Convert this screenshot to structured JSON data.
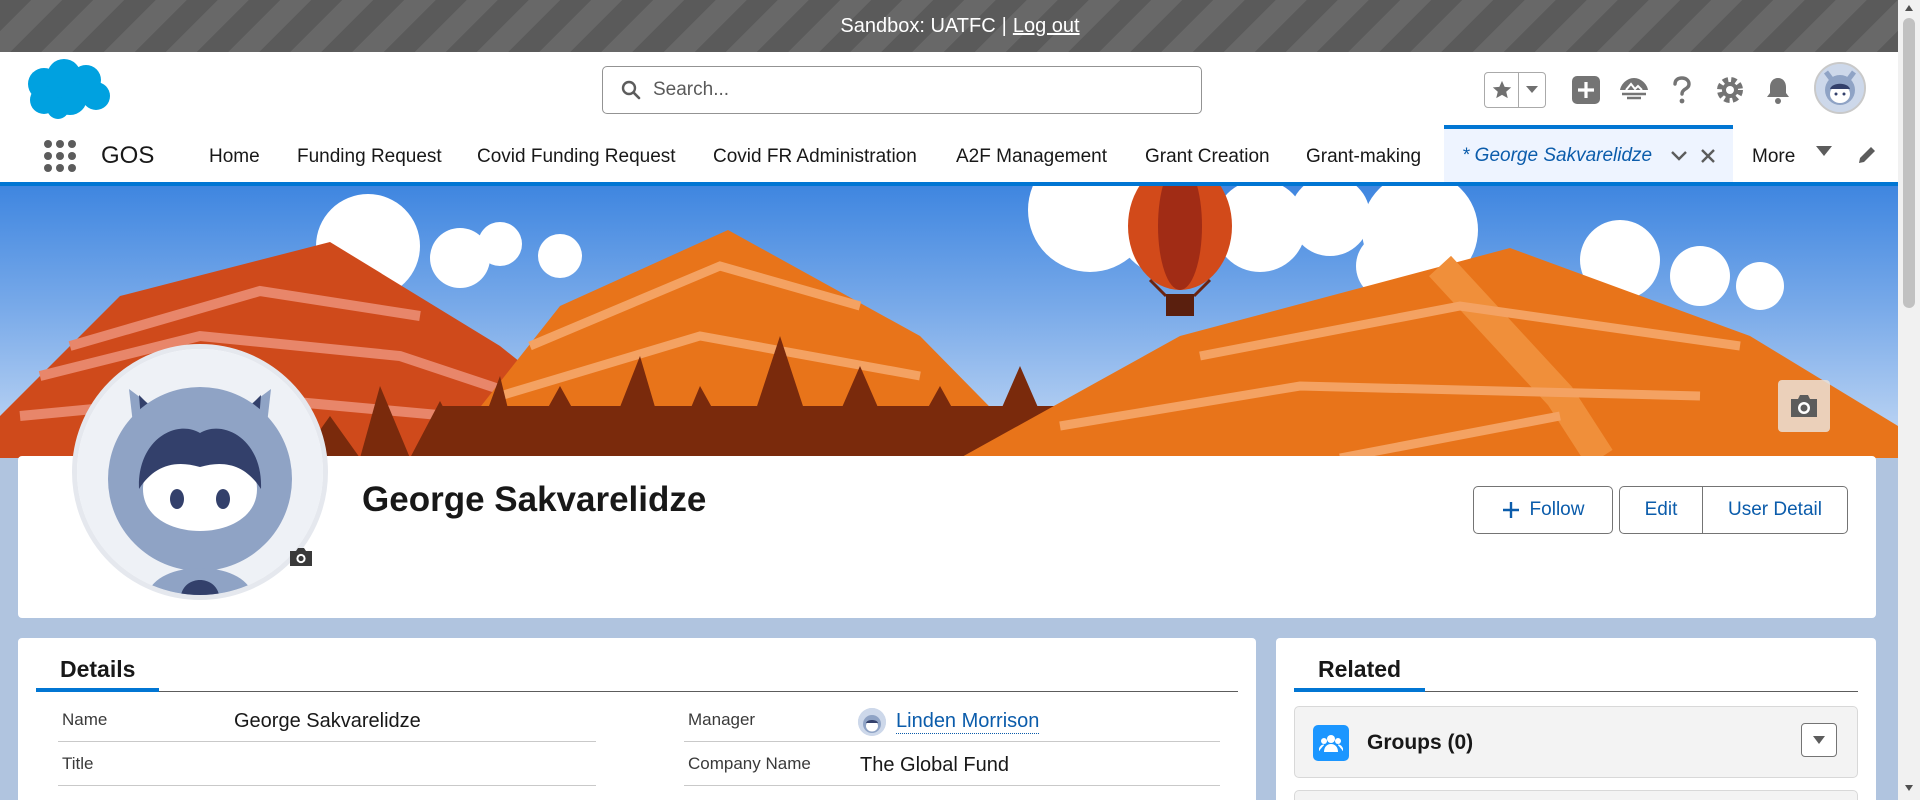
{
  "sandbox_bar": {
    "label": "Sandbox: UATFC",
    "separator": "|",
    "logout_link": "Log out"
  },
  "header": {
    "logo_icon": "salesforce-cloud-logo",
    "search": {
      "placeholder": "Search...",
      "value": ""
    },
    "tools": [
      "favorites-star-icon",
      "global-actions-plus-icon",
      "trailhead-icon",
      "help-icon",
      "setup-gear-icon",
      "notifications-bell-icon",
      "user-avatar"
    ]
  },
  "nav": {
    "app_name": "GOS",
    "items": [
      "Home",
      "Funding Request",
      "Covid Funding Request",
      "Covid FR Administration",
      "A2F Management",
      "Grant Creation",
      "Grant-making"
    ],
    "active_tab": "* George Sakvarelidze",
    "more_label": "More"
  },
  "profile": {
    "name": "George Sakvarelidze",
    "actions": {
      "follow": "Follow",
      "edit": "Edit",
      "user_detail": "User Detail"
    }
  },
  "details": {
    "tab_label": "Details",
    "fields_left": [
      {
        "label": "Name",
        "value": "George Sakvarelidze"
      },
      {
        "label": "Title",
        "value": ""
      }
    ],
    "fields_right": [
      {
        "label": "Manager",
        "value": "Linden Morrison",
        "is_link": true
      },
      {
        "label": "Company Name",
        "value": "The Global Fund"
      }
    ]
  },
  "related": {
    "tab_label": "Related",
    "groups_title": "Groups (0)"
  },
  "colors": {
    "brand_blue": "#0176d3",
    "link_blue": "#0b5cab",
    "background": "#b0c4df",
    "sandbox_bar": "#5f5f5f",
    "mountain_orange": "#d75a1f"
  }
}
